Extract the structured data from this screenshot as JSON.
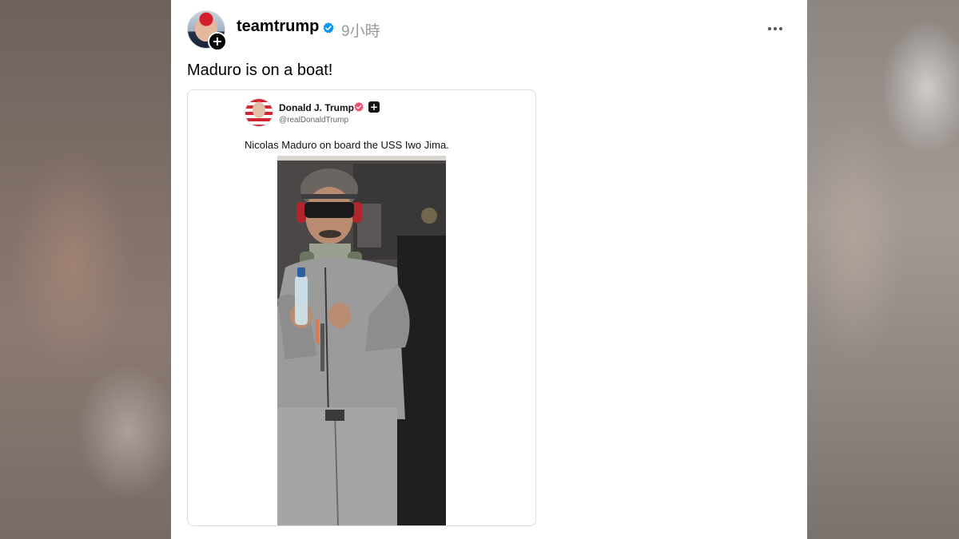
{
  "post": {
    "username": "teamtrump",
    "timestamp": "9小時",
    "caption": "Maduro is on a boat!",
    "follow_symbol": "+"
  },
  "embed": {
    "name": "Donald J. Trump",
    "handle": "@realDonaldTrump",
    "text": "Nicolas Maduro on board the USS Iwo Jima.",
    "plus_symbol": "+",
    "photo_alt": "Man in grey tracksuit, dark goggles and ear protection holding a water bottle"
  },
  "icons": {
    "verified": "verified-check-icon",
    "more": "more-options-icon",
    "embed_badge": "pink-verified-badge-icon"
  },
  "colors": {
    "verified_blue": "#0095f6",
    "embed_badge_pink": "#f0506e"
  }
}
